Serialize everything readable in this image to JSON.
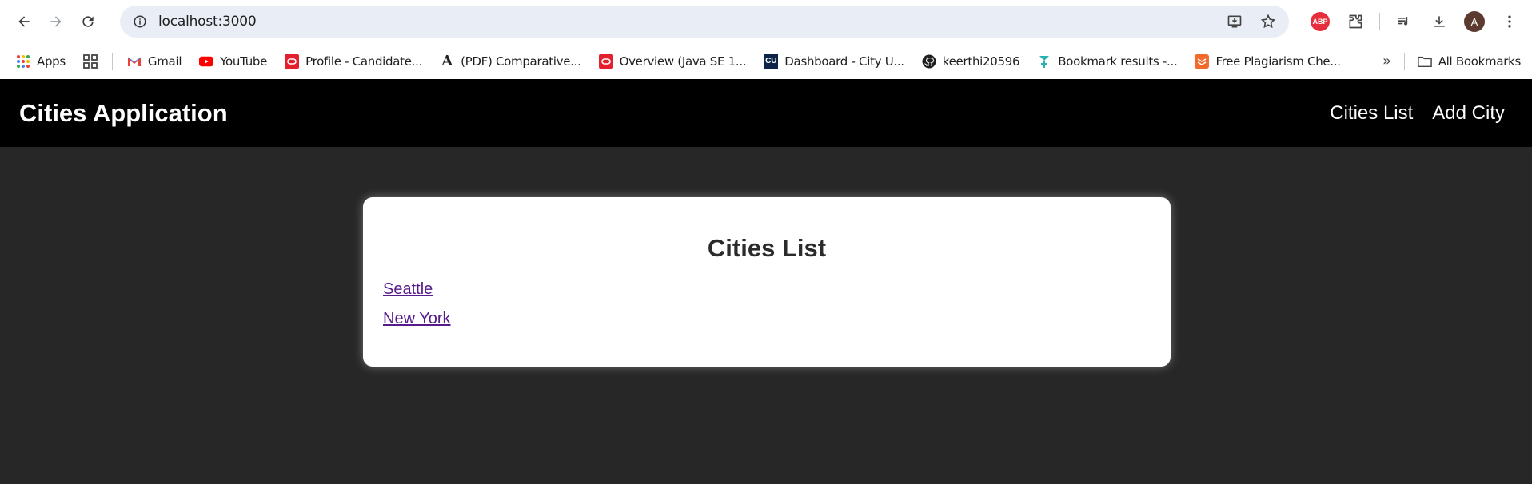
{
  "browser": {
    "url": "localhost:3000"
  },
  "bookmarks": {
    "items": [
      {
        "label": "Apps",
        "icon": "apps-grid-icon"
      },
      {
        "label": "Gmail",
        "icon": "gmail-icon"
      },
      {
        "label": "YouTube",
        "icon": "youtube-icon"
      },
      {
        "label": "Profile - Candidate...",
        "icon": "oracle-icon"
      },
      {
        "label": "(PDF) Comparative...",
        "icon": "academia-icon"
      },
      {
        "label": "Overview (Java SE 1...",
        "icon": "oracle-icon"
      },
      {
        "label": "Dashboard - City U...",
        "icon": "cu-icon"
      },
      {
        "label": "keerthi20596",
        "icon": "github-icon"
      },
      {
        "label": "Bookmark results -...",
        "icon": "bookmark-results-icon"
      },
      {
        "label": "Free Plagiarism Che...",
        "icon": "plagiarism-icon"
      }
    ],
    "all_bookmarks_label": "All Bookmarks"
  },
  "profile": {
    "initial": "A",
    "color": "#5d3a2f"
  },
  "app": {
    "title": "Cities Application",
    "nav": {
      "cities_list": "Cities List",
      "add_city": "Add City"
    },
    "card": {
      "heading": "Cities List",
      "cities": [
        "Seattle",
        "New York"
      ]
    }
  },
  "colors": {
    "header_bg": "#000000",
    "page_bg": "#272727",
    "link_visited": "#551a8b"
  }
}
